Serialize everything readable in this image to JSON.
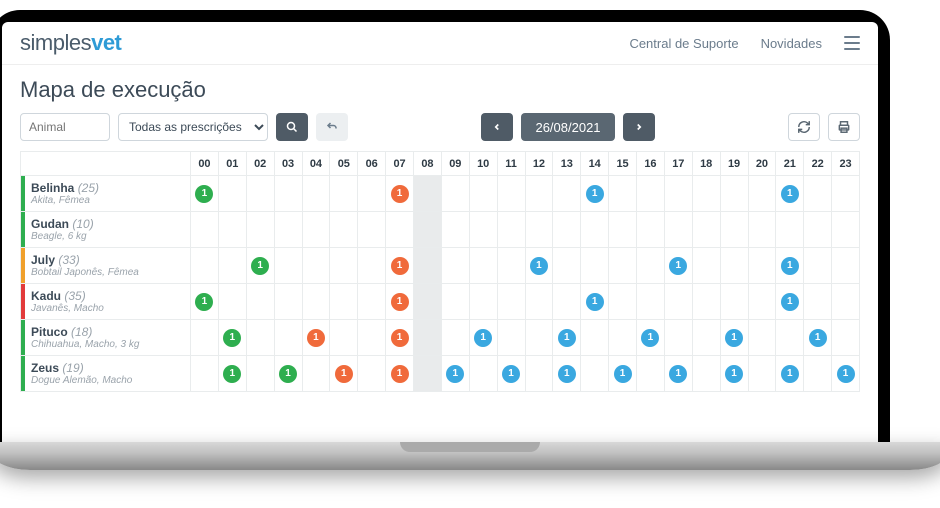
{
  "brand": {
    "part1": "simples",
    "part2": "vet"
  },
  "header": {
    "support": "Central de Suporte",
    "news": "Novidades"
  },
  "page_title": "Mapa de execução",
  "toolbar": {
    "animal_placeholder": "Animal",
    "prescriptions_label": "Todas as prescrições",
    "date": "26/08/2021"
  },
  "hours": [
    "00",
    "01",
    "02",
    "03",
    "04",
    "05",
    "06",
    "07",
    "08",
    "09",
    "10",
    "11",
    "12",
    "13",
    "14",
    "15",
    "16",
    "17",
    "18",
    "19",
    "20",
    "21",
    "22",
    "23"
  ],
  "highlight_hour": "08",
  "chart_data": {
    "type": "table",
    "title": "Mapa de execução",
    "hours": [
      "00",
      "01",
      "02",
      "03",
      "04",
      "05",
      "06",
      "07",
      "08",
      "09",
      "10",
      "11",
      "12",
      "13",
      "14",
      "15",
      "16",
      "17",
      "18",
      "19",
      "20",
      "21",
      "22",
      "23"
    ],
    "colors": {
      "green": "#2eae4f",
      "orange": "#f06a3b",
      "blue": "#3aa8e0"
    },
    "animals": [
      {
        "name": "Belinha",
        "count": 25,
        "sub": "Akita, Fêmea",
        "row_color": "green",
        "events": [
          {
            "hour": "00",
            "val": 1,
            "c": "green"
          },
          {
            "hour": "07",
            "val": 1,
            "c": "orange"
          },
          {
            "hour": "14",
            "val": 1,
            "c": "blue"
          },
          {
            "hour": "21",
            "val": 1,
            "c": "blue"
          }
        ]
      },
      {
        "name": "Gudan",
        "count": 10,
        "sub": "Beagle, 6 kg",
        "row_color": "green",
        "events": []
      },
      {
        "name": "July",
        "count": 33,
        "sub": "Bobtail Japonês, Fêmea",
        "row_color": "orange",
        "events": [
          {
            "hour": "02",
            "val": 1,
            "c": "green"
          },
          {
            "hour": "07",
            "val": 1,
            "c": "orange"
          },
          {
            "hour": "12",
            "val": 1,
            "c": "blue"
          },
          {
            "hour": "17",
            "val": 1,
            "c": "blue"
          },
          {
            "hour": "21",
            "val": 1,
            "c": "blue"
          }
        ]
      },
      {
        "name": "Kadu",
        "count": 35,
        "sub": "Javanês, Macho",
        "row_color": "red",
        "events": [
          {
            "hour": "00",
            "val": 1,
            "c": "green"
          },
          {
            "hour": "07",
            "val": 1,
            "c": "orange"
          },
          {
            "hour": "14",
            "val": 1,
            "c": "blue"
          },
          {
            "hour": "21",
            "val": 1,
            "c": "blue"
          }
        ]
      },
      {
        "name": "Pituco",
        "count": 18,
        "sub": "Chihuahua, Macho, 3 kg",
        "row_color": "green",
        "events": [
          {
            "hour": "01",
            "val": 1,
            "c": "green"
          },
          {
            "hour": "04",
            "val": 1,
            "c": "orange"
          },
          {
            "hour": "07",
            "val": 1,
            "c": "orange"
          },
          {
            "hour": "10",
            "val": 1,
            "c": "blue"
          },
          {
            "hour": "13",
            "val": 1,
            "c": "blue"
          },
          {
            "hour": "16",
            "val": 1,
            "c": "blue"
          },
          {
            "hour": "19",
            "val": 1,
            "c": "blue"
          },
          {
            "hour": "22",
            "val": 1,
            "c": "blue"
          }
        ]
      },
      {
        "name": "Zeus",
        "count": 19,
        "sub": "Dogue Alemão, Macho",
        "row_color": "green",
        "events": [
          {
            "hour": "01",
            "val": 1,
            "c": "green"
          },
          {
            "hour": "03",
            "val": 1,
            "c": "green"
          },
          {
            "hour": "05",
            "val": 1,
            "c": "orange"
          },
          {
            "hour": "07",
            "val": 1,
            "c": "orange"
          },
          {
            "hour": "09",
            "val": 1,
            "c": "blue"
          },
          {
            "hour": "11",
            "val": 1,
            "c": "blue"
          },
          {
            "hour": "13",
            "val": 1,
            "c": "blue"
          },
          {
            "hour": "15",
            "val": 1,
            "c": "blue"
          },
          {
            "hour": "17",
            "val": 1,
            "c": "blue"
          },
          {
            "hour": "19",
            "val": 1,
            "c": "blue"
          },
          {
            "hour": "21",
            "val": 1,
            "c": "blue"
          },
          {
            "hour": "23",
            "val": 1,
            "c": "blue"
          }
        ]
      }
    ]
  }
}
